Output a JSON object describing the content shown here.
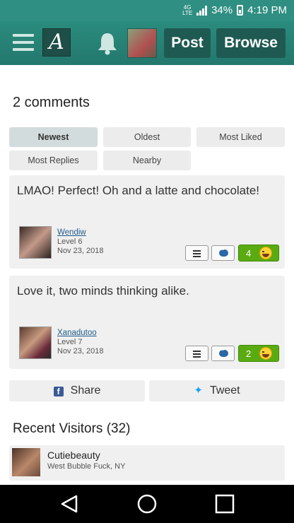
{
  "status_bar": {
    "network": "4G LTE",
    "battery": "34%",
    "time": "4:19 PM"
  },
  "header": {
    "logo_letter": "A",
    "post_label": "Post",
    "browse_label": "Browse"
  },
  "comments": {
    "title": "2 comments",
    "sort_tabs": [
      {
        "label": "Newest",
        "active": true
      },
      {
        "label": "Oldest",
        "active": false
      },
      {
        "label": "Most Liked",
        "active": false
      },
      {
        "label": "Most Replies",
        "active": false
      },
      {
        "label": "Nearby",
        "active": false
      }
    ],
    "items": [
      {
        "text": "LMAO! Perfect! Oh and a latte and chocolate!",
        "user": "Wendiw",
        "level": "Level 6",
        "date": "Nov 23, 2018",
        "likes": "4"
      },
      {
        "text": "Love it, two minds thinking alike.",
        "user": "Xanadutoo",
        "level": "Level 7",
        "date": "Nov 23, 2018",
        "likes": "2"
      }
    ]
  },
  "share": {
    "facebook_label": "Share",
    "twitter_label": "Tweet"
  },
  "visitors": {
    "title": "Recent Visitors (32)",
    "items": [
      {
        "name": "Cutiebeauty",
        "location": "West Bubble Fuck, NY"
      }
    ]
  },
  "colors": {
    "header_teal": "#2a8c7e",
    "button_dark": "#1f5a52",
    "like_green": "#5aab12"
  }
}
